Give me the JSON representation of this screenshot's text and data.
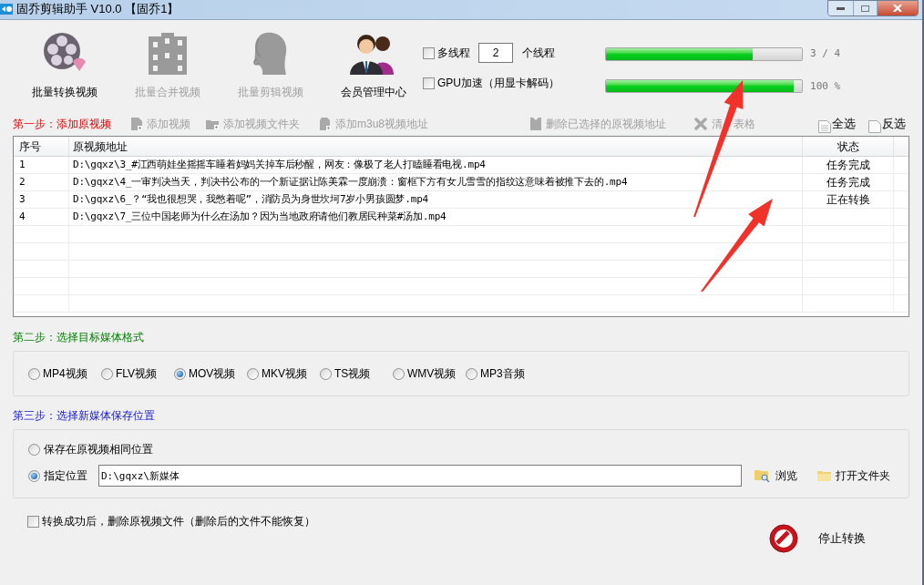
{
  "window": {
    "title": "固乔剪辑助手 V10.0 【固乔1】"
  },
  "toolbar": [
    {
      "kind": "convert",
      "label": "批量转换视频",
      "disabled": false
    },
    {
      "kind": "merge",
      "label": "批量合并视频",
      "disabled": true
    },
    {
      "kind": "edit",
      "label": "批量剪辑视频",
      "disabled": true
    },
    {
      "kind": "member",
      "label": "会员管理中心",
      "disabled": false
    }
  ],
  "options": {
    "multithread": {
      "label": "多线程",
      "checked": false
    },
    "thread_count": {
      "value": "2",
      "suffix": "个线程"
    },
    "gpu": {
      "label": "GPU加速（用显卡解码）",
      "checked": false
    }
  },
  "progress": [
    {
      "level": 0.75,
      "reading": "3 / 4"
    },
    {
      "level": 0.96,
      "reading": "100 %"
    }
  ],
  "step1": {
    "title": "第一步：添加原视频",
    "actions": [
      {
        "kind": "add-file",
        "label": "添加视频",
        "disabled": true
      },
      {
        "kind": "add-folder",
        "label": "添加视频文件夹",
        "disabled": true
      },
      {
        "kind": "add-url",
        "label": "添加m3u8视频地址",
        "disabled": true
      },
      {
        "kind": "delete",
        "label": "删除已选择的原视频地址",
        "disabled": true
      },
      {
        "kind": "clear",
        "label": "清　表格",
        "disabled": true
      }
    ],
    "select_all": "全选",
    "invert": "反选"
  },
  "table": {
    "columns": [
      "序号",
      "原视频地址",
      "状态"
    ],
    "rows": [
      {
        "index": "1",
        "path": "D:\\gqxz\\3_#江西萌娃坐摇摇车睡着妈妈关掉车后秒醒，网友：像极了老人打瞌睡看电视.mp4",
        "status": "任务完成"
      },
      {
        "index": "2",
        "path": "D:\\gqxz\\4_一审判决当天，判决书公布的一个新证据让陈美霖一度崩溃：窗框下方有女儿雪雪的指纹这意味着被推下去的.mp4",
        "status": "任务完成"
      },
      {
        "index": "3",
        "path": "D:\\gqxz\\6_？“我也很想哭，我憋着呢”，消防员为身世坎坷7岁小男孩圆梦.mp4",
        "status": "正在转换"
      },
      {
        "index": "4",
        "path": "D:\\gqxz\\7_三位中国老师为什么在汤加？因为当地政府请他们教居民种菜#汤加.mp4"
      }
    ]
  },
  "step2": {
    "title": "第二步：选择目标媒体格式",
    "formats": [
      {
        "label": "MP4视频",
        "selected": false
      },
      {
        "label": "FLV视频",
        "selected": false
      },
      {
        "label": "MOV视频",
        "selected": true
      },
      {
        "label": "MKV视频",
        "selected": false
      },
      {
        "label": "TS视频",
        "selected": false
      },
      {
        "label": "WMV视频",
        "selected": false
      },
      {
        "label": "MP3音频",
        "selected": false
      }
    ]
  },
  "step3": {
    "title": "第三步：选择新媒体保存位置",
    "locations": [
      {
        "label": "保存在原视频相同位置",
        "selected": false
      },
      {
        "label": "指定位置",
        "selected": true
      }
    ],
    "path": "D:\\gqxz\\新媒体",
    "browse": "浏览",
    "open_folder": "打开文件夹"
  },
  "delete_after": {
    "label": "转换成功后，删除原视频文件（删除后的文件不能恢复）",
    "checked": false
  },
  "stop_button": "停止转换",
  "annotations": [
    {
      "kind": "arrow"
    },
    {
      "kind": "arrow"
    }
  ]
}
